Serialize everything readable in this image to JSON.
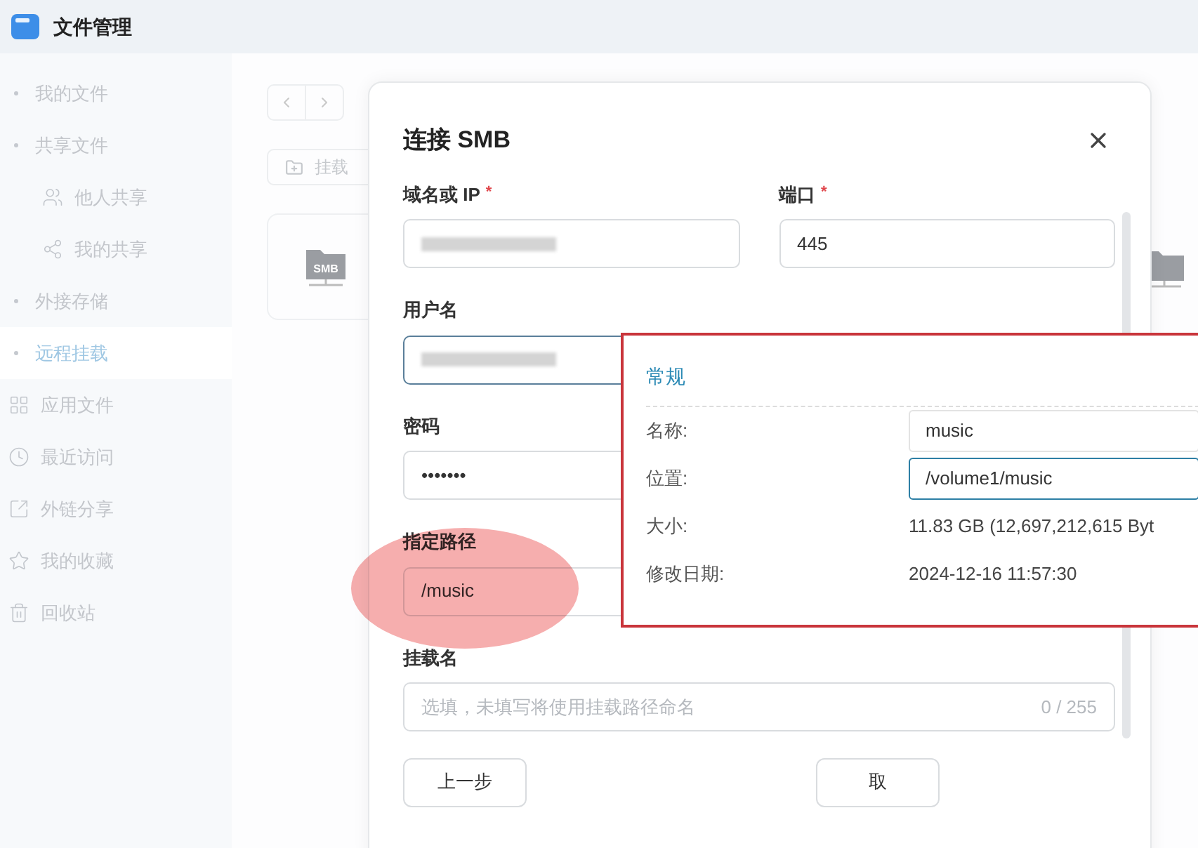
{
  "app": {
    "title": "文件管理"
  },
  "sidebar": {
    "items": [
      {
        "label": "我的文件",
        "kind": "group",
        "selected": false
      },
      {
        "label": "共享文件",
        "kind": "group",
        "selected": false,
        "children": [
          {
            "label": "他人共享",
            "kind": "link",
            "selected": false
          },
          {
            "label": "我的共享",
            "kind": "link",
            "selected": false
          }
        ]
      },
      {
        "label": "外接存储",
        "kind": "group",
        "selected": false
      },
      {
        "label": "远程挂载",
        "kind": "group",
        "selected": true
      },
      {
        "label": "应用文件",
        "kind": "link",
        "selected": false
      },
      {
        "label": "最近访问",
        "kind": "link",
        "selected": false
      },
      {
        "label": "外链分享",
        "kind": "link",
        "selected": false
      },
      {
        "label": "我的收藏",
        "kind": "link",
        "selected": false
      },
      {
        "label": "回收站",
        "kind": "link",
        "selected": false
      }
    ]
  },
  "toolbar": {
    "mount_button": "挂载"
  },
  "card": {
    "icon_text": "SMB"
  },
  "dialog": {
    "title": "连接 SMB",
    "fields": [
      {
        "label": "域名或 IP",
        "required_mark": "*",
        "kind": "redacted",
        "focused": false
      },
      {
        "label": "端口",
        "required_mark": "*",
        "kind": "text",
        "value": "445",
        "focused": false
      },
      {
        "label": "用户名",
        "kind": "redacted",
        "focused": true
      },
      {
        "label": "密码",
        "kind": "text",
        "value": "•••••••",
        "focused": false
      },
      {
        "label": "指定路径",
        "kind": "text",
        "value": "/music",
        "focused": false
      },
      {
        "label": "挂载名",
        "kind": "text",
        "placeholder": "选填，未填写将使用挂载路径命名",
        "counter": "0 / 255",
        "focused": false
      }
    ],
    "buttons": [
      {
        "label": "上一步"
      },
      {
        "label": "取"
      }
    ]
  },
  "properties": {
    "section": "常规",
    "rows": [
      {
        "label": "名称:",
        "value": "music",
        "kind": "field",
        "focused": false
      },
      {
        "label": "位置:",
        "value": "/volume1/music",
        "kind": "field",
        "focused": true
      },
      {
        "label": "大小:",
        "value": "11.83 GB (12,697,212,615 Byt",
        "kind": "text"
      },
      {
        "label": "修改日期:",
        "value": "2024-12-16 11:57:30",
        "kind": "text"
      }
    ]
  }
}
